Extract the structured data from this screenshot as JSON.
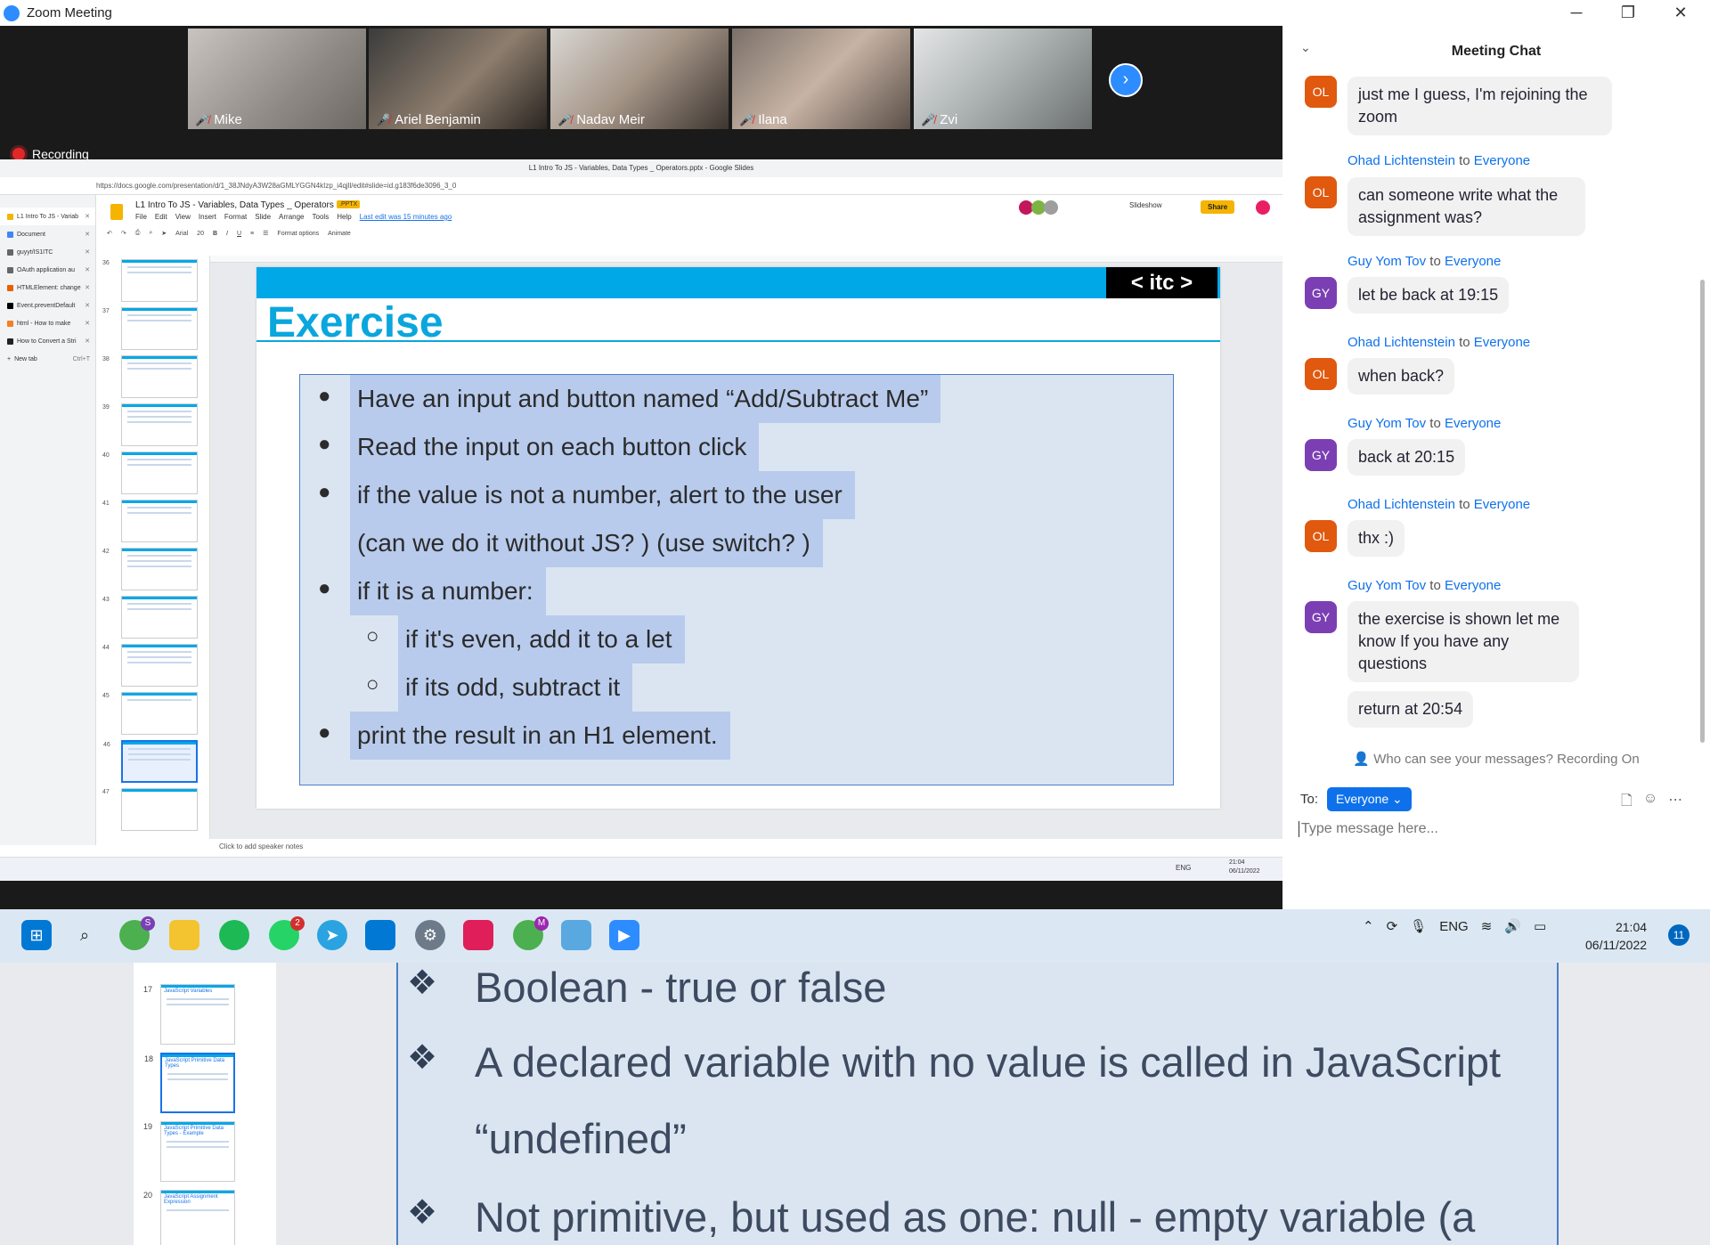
{
  "window": {
    "title": "Zoom Meeting",
    "minimize": "─",
    "restore": "❐",
    "close": "✕"
  },
  "participants": [
    {
      "name": "Mike"
    },
    {
      "name": "Ariel Benjamin"
    },
    {
      "name": "Nadav Meir"
    },
    {
      "name": "Ilana"
    },
    {
      "name": "Zvi"
    }
  ],
  "recording": {
    "label": "Recording"
  },
  "shared": {
    "browser_title": "L1 Intro To JS - Variables, Data Types _ Operators.pptx - Google Slides",
    "url": "https://docs.google.com/presentation/d/1_38JNdyA3W28aGMLYGGN4kIzp_i4qjll/edit#slide=id.g183f6de3096_3_0",
    "tabs": [
      "L1 Intro To JS - Variab",
      "Document",
      "guyyt/IS1ITC",
      "OAuth application au",
      "HTMLElement: change",
      "Event.preventDefault",
      "html - How to make",
      "How to Convert a Stri",
      "New tab"
    ],
    "new_tab_shortcut": "Ctrl+T",
    "doc_title": "L1 Intro To JS - Variables, Data Types _ Operators",
    "format_badge": ".PPTX",
    "menu": [
      "File",
      "Edit",
      "View",
      "Insert",
      "Format",
      "Slide",
      "Arrange",
      "Tools",
      "Help"
    ],
    "last_edit": "Last edit was 15 minutes ago",
    "toolbar_font": "Arial",
    "toolbar_size": "20",
    "format_options": "Format options",
    "animate": "Animate",
    "slideshow": "Slideshow",
    "share": "Share",
    "slide_numbers": [
      "36",
      "37",
      "38",
      "39",
      "40",
      "41",
      "42",
      "43",
      "44",
      "45",
      "46",
      "47"
    ],
    "speaker_notes": "Click to add speaker notes",
    "slide": {
      "logo": "< itc >",
      "heading": "Exercise",
      "lines": [
        "Have an input and button named “Add/Subtract  Me”",
        "Read the input on each button click",
        "if the value is not a number, alert to the user",
        "(can we do it without JS? ) (use switch? )",
        "if it is a number:",
        "if it's even, add it to a let",
        "if its odd, subtract it",
        "print the result in an H1 element."
      ]
    },
    "inner_tray": {
      "lang": "ENG",
      "time": "21:04",
      "date": "06/11/2022"
    }
  },
  "chat": {
    "title": "Meeting Chat",
    "messages": [
      {
        "avatar": "OL",
        "text": "just me I guess, I'm rejoining the zoom"
      },
      {
        "sender": "Ohad Lichtenstein",
        "to": "to",
        "recipient": "Everyone",
        "avatar": "OL",
        "text": "can someone write what the assignment was?"
      },
      {
        "sender": "Guy Yom Tov",
        "to": "to",
        "recipient": "Everyone",
        "avatar": "GY",
        "text": "let be back at 19:15"
      },
      {
        "sender": "Ohad Lichtenstein",
        "to": "to",
        "recipient": "Everyone",
        "avatar": "OL",
        "text": "when back?"
      },
      {
        "sender": "Guy Yom Tov",
        "to": "to",
        "recipient": "Everyone",
        "avatar": "GY",
        "text": "back at 20:15"
      },
      {
        "sender": "Ohad Lichtenstein",
        "to": "to",
        "recipient": "Everyone",
        "avatar": "OL",
        "text": "thx :)"
      },
      {
        "sender": "Guy Yom Tov",
        "to": "to",
        "recipient": "Everyone",
        "avatar": "GY",
        "text": "the exercise is shown let me know If you have any questions"
      },
      {
        "text": "return at 20:54"
      }
    ],
    "visibility": "Who can see your messages? Recording On",
    "to_label": "To:",
    "recipient": "Everyone",
    "placeholder": "Type message here..."
  },
  "taskbar": {
    "chrome_badge": "S",
    "whatsapp_badge": "2",
    "chrome2_badge": "M",
    "lang": "ENG",
    "time": "21:04",
    "date": "06/11/2022",
    "notifications": "11"
  },
  "bottom_slides": {
    "numbers": [
      "17",
      "18",
      "19",
      "20"
    ],
    "thumb_titles": [
      "JavaScript Variables",
      "JavaScript Primitive Data Types",
      "JavaScript Primitive Data Types - Example",
      "JavaScript Assignment Expression"
    ],
    "lines": [
      "Boolean - true or false",
      "A declared variable with no value is called in JavaScript",
      "“undefined”",
      "Not primitive, but used as one: null - empty variable (a"
    ]
  },
  "colors": {
    "zoom_blue": "#2d8cff",
    "slide_blue": "#00a8e8",
    "selection": "#b8cbed",
    "ol_avatar": "#e0590f",
    "gy_avatar": "#7b3fb3"
  }
}
